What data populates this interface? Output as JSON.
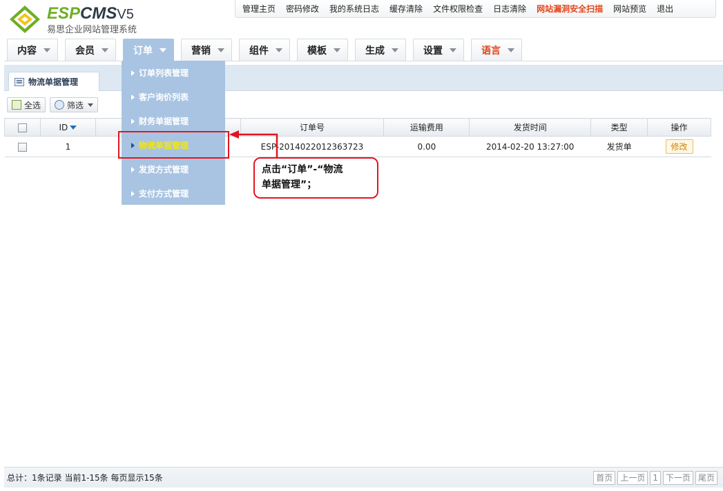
{
  "brand": {
    "logo_esp": "ESP",
    "logo_cms": "CMS",
    "logo_version": "V5",
    "subtitle": "易思企业网站管理系统"
  },
  "topnav": {
    "items": [
      {
        "label": "管理主页",
        "highlight": false
      },
      {
        "label": "密码修改",
        "highlight": false
      },
      {
        "label": "我的系统日志",
        "highlight": false
      },
      {
        "label": "缓存清除",
        "highlight": false
      },
      {
        "label": "文件权限检查",
        "highlight": false
      },
      {
        "label": "日志清除",
        "highlight": false
      },
      {
        "label": "网站漏洞安全扫描",
        "highlight": true
      },
      {
        "label": "网站预览",
        "highlight": false
      },
      {
        "label": "退出",
        "highlight": false
      }
    ]
  },
  "mainnav": {
    "tabs": [
      {
        "label": "内容"
      },
      {
        "label": "会员"
      },
      {
        "label": "订单",
        "active": true
      },
      {
        "label": "营销"
      },
      {
        "label": "组件"
      },
      {
        "label": "模板"
      },
      {
        "label": "生成"
      },
      {
        "label": "设置"
      },
      {
        "label": "语言",
        "red": true
      }
    ]
  },
  "dropdown": {
    "items": [
      {
        "label": "订单列表管理"
      },
      {
        "label": "客户询价列表"
      },
      {
        "label": "财务单据管理"
      },
      {
        "label": "物流单据管理",
        "highlight": true
      },
      {
        "label": "发货方式管理"
      },
      {
        "label": "支付方式管理"
      }
    ]
  },
  "page": {
    "tab_title": "物流单据管理"
  },
  "toolbar": {
    "select_all": "全选",
    "filter": "筛选"
  },
  "table": {
    "headers": {
      "id": "ID",
      "order_no": "订单号",
      "freight": "运输费用",
      "ship_time": "发货时间",
      "type": "类型",
      "action": "操作"
    },
    "rows": [
      {
        "id": "1",
        "order_no": "ESP-2014022012363723",
        "freight": "0.00",
        "ship_time": "2014-02-20 13:27:00",
        "type": "发货单",
        "action": "修改"
      }
    ]
  },
  "annotation": {
    "line1": "点击“订单”-“物流",
    "line2": "单据管理”；"
  },
  "footer": {
    "info": "总计：1条记录 当前1-15条 每页显示15条",
    "pager": [
      "首页",
      "上一页",
      "1",
      "下一页",
      "尾页"
    ]
  },
  "colors": {
    "accent_blue": "#a9c4e2",
    "highlight_yellow": "#f7e600",
    "annotation_red": "#e3141e",
    "warn_orange": "#e2461b"
  }
}
